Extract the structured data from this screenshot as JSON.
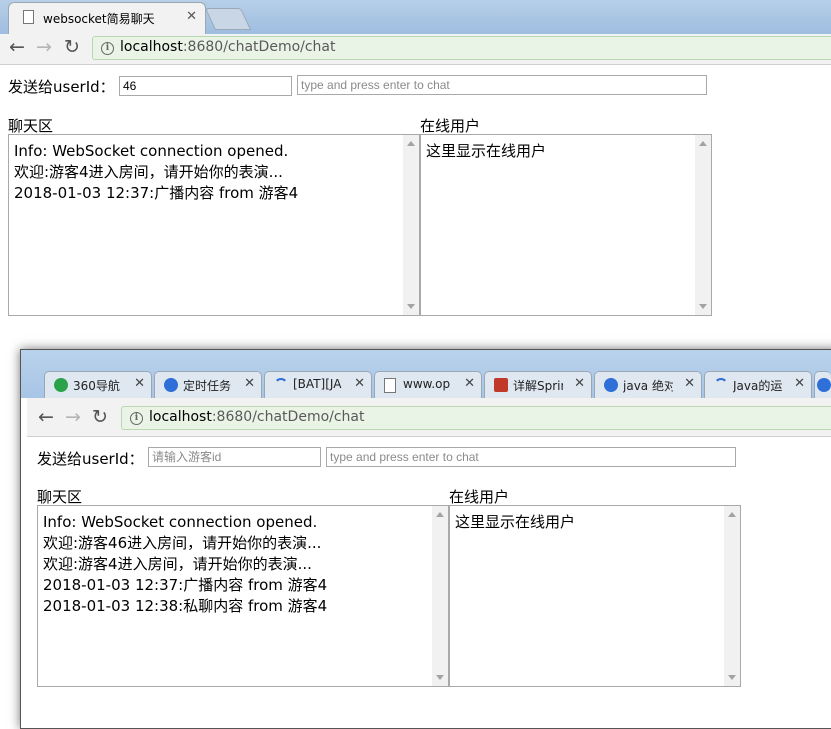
{
  "browser1": {
    "tab_title": "websocket简易聊天",
    "url_host": "localhost",
    "url_rest": ":8680/chatDemo/chat",
    "form": {
      "send_to_label": "发送给userId：",
      "userid_value": "46",
      "message_placeholder": "type and press enter to chat"
    },
    "chat_label": "聊天区",
    "online_label": "在线用户",
    "messages": [
      "Info: WebSocket connection opened.",
      "欢迎:游客4进入房间，请开始你的表演...",
      "2018-01-03 12:37:广播内容 from 游客4"
    ],
    "online_text": "这里显示在线用户"
  },
  "browser2": {
    "tabs": [
      {
        "title": "360导航",
        "icon": "360-icon",
        "color": "#2aa34a"
      },
      {
        "title": "定时任务",
        "icon": "baidu-paw-icon",
        "color": "#2f6fd8"
      },
      {
        "title": "[BAT][JA",
        "icon": "loading-icon",
        "color": "#2f6fd8"
      },
      {
        "title": "www.op",
        "icon": "page-icon",
        "color": "#777777"
      },
      {
        "title": "详解Sprin",
        "icon": "b-logo-icon",
        "color": "#c0392b"
      },
      {
        "title": "java 绝对",
        "icon": "baidu-paw-icon",
        "color": "#2f6fd8"
      },
      {
        "title": "Java的运",
        "icon": "loading-icon",
        "color": "#2f6fd8"
      }
    ],
    "url_host": "localhost",
    "url_rest": ":8680/chatDemo/chat",
    "form": {
      "send_to_label": "发送给userId：",
      "userid_placeholder": "请输入游客id",
      "message_placeholder": "type and press enter to chat"
    },
    "chat_label": "聊天区",
    "online_label": "在线用户",
    "messages": [
      "Info: WebSocket connection opened.",
      "欢迎:游客46进入房间，请开始你的表演...",
      "欢迎:游客4进入房间，请开始你的表演...",
      "2018-01-03 12:37:广播内容 from 游客4",
      "2018-01-03 12:38:私聊内容 from 游客4"
    ],
    "online_text": "这里显示在线用户"
  }
}
